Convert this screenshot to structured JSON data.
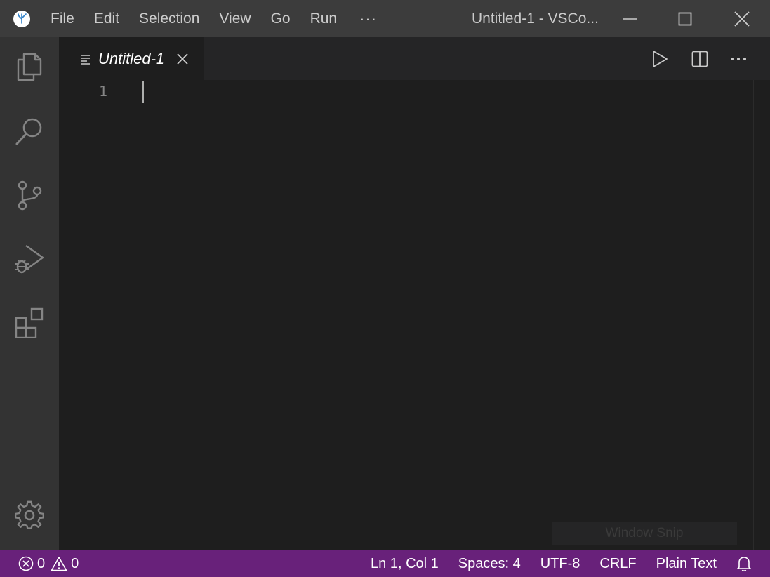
{
  "titlebar": {
    "menu": [
      "File",
      "Edit",
      "Selection",
      "View",
      "Go",
      "Run"
    ],
    "more_label": "···",
    "window_title": "Untitled-1 - VSCo..."
  },
  "window_controls": [
    "minimize-icon",
    "maximize-icon",
    "close-icon"
  ],
  "activity_bar": {
    "items": [
      "explorer-icon",
      "search-icon",
      "source-control-icon",
      "run-debug-icon",
      "extensions-icon"
    ],
    "bottom": "gear-icon"
  },
  "tab": {
    "label": "Untitled-1",
    "icon": "plain-text-file-icon"
  },
  "editor_actions": [
    "run-icon",
    "split-editor-icon",
    "more-actions-icon"
  ],
  "editor": {
    "line_numbers": [
      "1"
    ]
  },
  "overlay": {
    "window_snip": "Window Snip"
  },
  "status_bar": {
    "errors": "0",
    "warnings": "0",
    "position": "Ln 1, Col 1",
    "spaces": "Spaces: 4",
    "encoding": "UTF-8",
    "eol": "CRLF",
    "language": "Plain Text"
  },
  "colors": {
    "titlebar": "#3c3c3c",
    "activitybar": "#333333",
    "editor": "#1e1e1e",
    "statusbar": "#68217a"
  }
}
